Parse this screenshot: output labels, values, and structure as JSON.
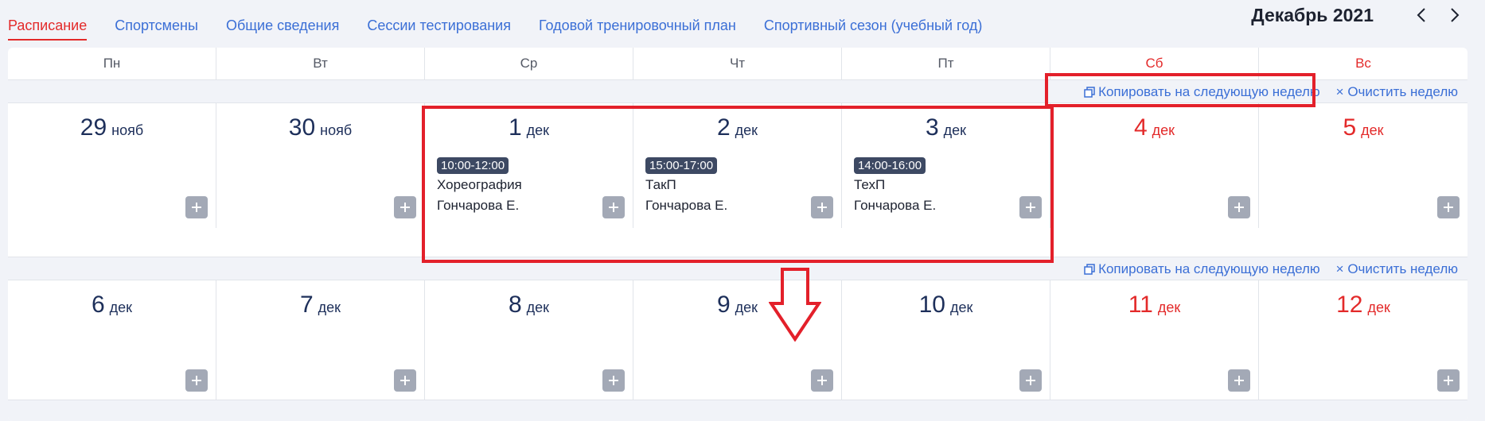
{
  "tabs": [
    {
      "label": "Расписание",
      "active": true
    },
    {
      "label": "Спортсмены",
      "active": false
    },
    {
      "label": "Общие сведения",
      "active": false
    },
    {
      "label": "Сессии тестирования",
      "active": false
    },
    {
      "label": "Годовой тренировочный план",
      "active": false
    },
    {
      "label": "Спортивный сезон (учебный год)",
      "active": false
    }
  ],
  "month": {
    "title": "Декабрь 2021",
    "prev_icon": "chevron-left-icon",
    "next_icon": "chevron-right-icon"
  },
  "weekdays": [
    "Пн",
    "Вт",
    "Ср",
    "Чт",
    "Пт",
    "Сб",
    "Вс"
  ],
  "week_actions": {
    "copy_label": "Копировать на следующую неделю",
    "clear_label": "× Очистить неделю"
  },
  "weeks": [
    {
      "days": [
        {
          "num": "29",
          "month": "нояб"
        },
        {
          "num": "30",
          "month": "нояб"
        },
        {
          "num": "1",
          "month": "дек",
          "event": {
            "time": "10:00-12:00",
            "title": "Хореография",
            "coach": "Гончарова Е."
          }
        },
        {
          "num": "2",
          "month": "дек",
          "event": {
            "time": "15:00-17:00",
            "title": "ТакП",
            "coach": "Гончарова Е."
          }
        },
        {
          "num": "3",
          "month": "дек",
          "event": {
            "time": "14:00-16:00",
            "title": "ТехП",
            "coach": "Гончарова Е."
          }
        },
        {
          "num": "4",
          "month": "дек"
        },
        {
          "num": "5",
          "month": "дек"
        }
      ]
    },
    {
      "days": [
        {
          "num": "6",
          "month": "дек"
        },
        {
          "num": "7",
          "month": "дек"
        },
        {
          "num": "8",
          "month": "дек"
        },
        {
          "num": "9",
          "month": "дек"
        },
        {
          "num": "10",
          "month": "дек"
        },
        {
          "num": "11",
          "month": "дек"
        },
        {
          "num": "12",
          "month": "дек"
        }
      ]
    }
  ],
  "colors": {
    "accent": "#3b6fd6",
    "weekend": "#e32a2a",
    "event_badge": "#3d4963",
    "add_button": "#a3a9b6",
    "annotation": "#e3202a"
  }
}
